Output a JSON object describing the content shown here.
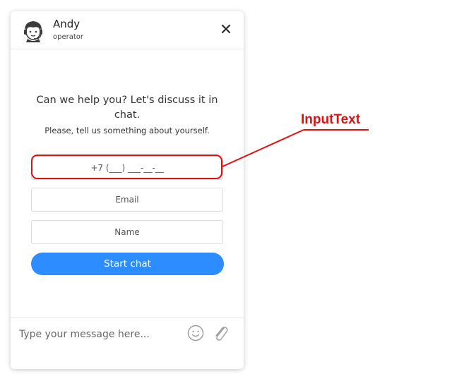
{
  "header": {
    "operator_name": "Andy",
    "operator_role": "operator",
    "avatar_icon": "operator-headset-avatar",
    "close_icon": "close-icon"
  },
  "main": {
    "greeting": "Can we help you? Let's discuss it in chat.",
    "subgreeting": "Please, tell us something about yourself.",
    "phone_placeholder": "+7 (___) ___-__-__",
    "email_placeholder": "Email",
    "name_placeholder": "Name",
    "start_button": "Start chat"
  },
  "footer": {
    "message_placeholder": "Type your message here...",
    "emoji_icon": "emoji-icon",
    "attach_icon": "paperclip-icon"
  },
  "annotation": {
    "label": "InputText",
    "color": "#e01010"
  },
  "colors": {
    "accent": "#2d8cff"
  }
}
